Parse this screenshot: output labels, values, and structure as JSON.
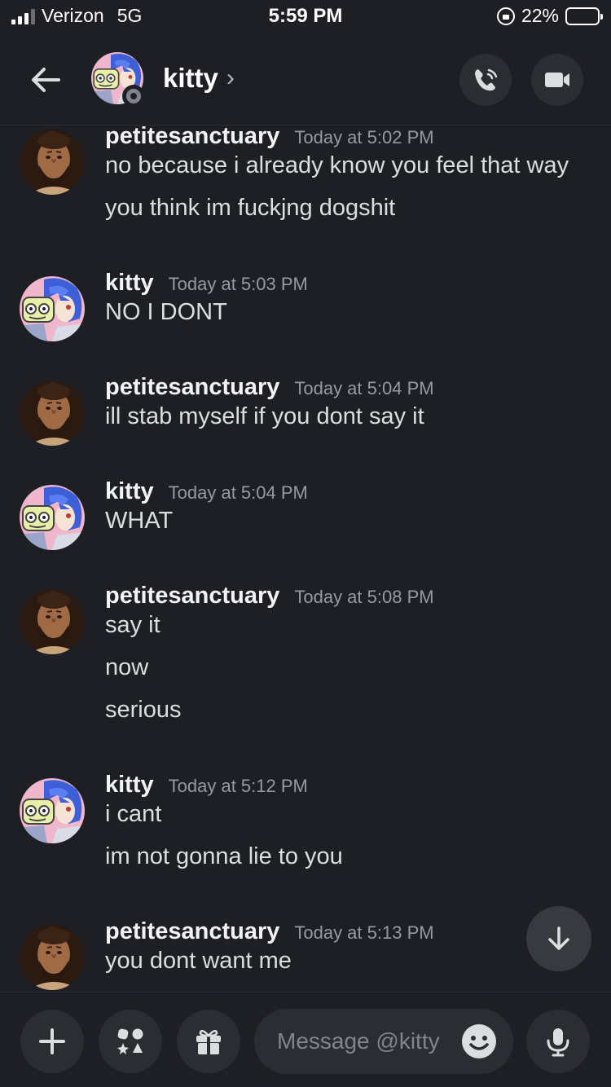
{
  "status_bar": {
    "carrier": "Verizon",
    "network": "5G",
    "time": "5:59 PM",
    "battery_text": "22%",
    "battery_level": 0.22
  },
  "header": {
    "title": "kitty",
    "chevron": "›",
    "icons": [
      "back-arrow-icon",
      "call-icon",
      "video-icon"
    ]
  },
  "messages": [
    {
      "author": "petitesanctuary",
      "avatar": "caveman-avatar",
      "timestamp": "Today at 5:02 PM",
      "lines": [
        "no because i already know you feel that way",
        "you think im fuckjng dogshit"
      ]
    },
    {
      "author": "kitty",
      "avatar": "anime-avatar",
      "timestamp": "Today at 5:03 PM",
      "lines": [
        "NO I DONT"
      ]
    },
    {
      "author": "petitesanctuary",
      "avatar": "caveman-avatar",
      "timestamp": "Today at 5:04 PM",
      "lines": [
        "ill stab myself if you dont say it"
      ]
    },
    {
      "author": "kitty",
      "avatar": "anime-avatar",
      "timestamp": "Today at 5:04 PM",
      "lines": [
        "WHAT"
      ]
    },
    {
      "author": "petitesanctuary",
      "avatar": "caveman-avatar",
      "timestamp": "Today at 5:08 PM",
      "lines": [
        "say it",
        "now",
        "serious"
      ]
    },
    {
      "author": "kitty",
      "avatar": "anime-avatar",
      "timestamp": "Today at 5:12 PM",
      "lines": [
        "i cant",
        "im not gonna lie to you"
      ]
    },
    {
      "author": "petitesanctuary",
      "avatar": "caveman-avatar",
      "timestamp": "Today at 5:13 PM",
      "lines": [
        "you dont want me"
      ]
    }
  ],
  "composer": {
    "placeholder": "Message @kitty",
    "icons": [
      "plus-icon",
      "apps-icon",
      "gift-icon",
      "emoji-icon",
      "microphone-icon"
    ]
  },
  "colors": {
    "background": "#1e1f24",
    "surface": "#2b2d33",
    "username": "#f2f3f5",
    "timestamp": "#949ba4",
    "message_text": "#dbdee1"
  }
}
